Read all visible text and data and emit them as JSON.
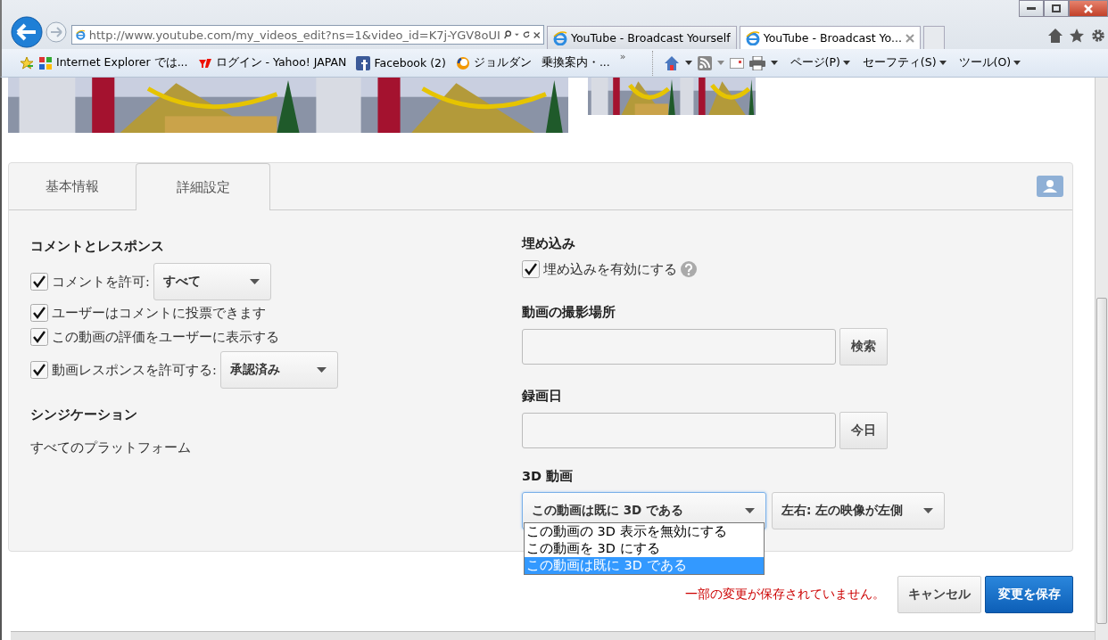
{
  "browser": {
    "address": "http://www.youtube.com/my_videos_edit?ns=1&video_id=K7j-YGV8oUI",
    "tabs": [
      {
        "label": "YouTube - Broadcast Yourself",
        "selected": false
      },
      {
        "label": "YouTube - Broadcast Yo...",
        "selected": true
      }
    ],
    "favorites": [
      "Internet Explorer では...",
      "ログイン - Yahoo! JAPAN",
      "Facebook (2)",
      "ジョルダン",
      "乗換案内・..."
    ],
    "overflow_mark": "»",
    "commands": [
      "ページ(P)",
      "セーフティ(S)",
      "ツール(O)"
    ]
  },
  "page": {
    "tabs": [
      {
        "label": "基本情報",
        "selected": false
      },
      {
        "label": "詳細設定",
        "selected": true
      }
    ],
    "left": {
      "heading": "コメントとレスポンス",
      "options": [
        {
          "label": "コメントを許可:",
          "checked": true,
          "select": "すべて"
        },
        {
          "label": "ユーザーはコメントに投票できます",
          "checked": true
        },
        {
          "label": "この動画の評価をユーザーに表示する",
          "checked": true
        },
        {
          "label": "動画レスポンスを許可する:",
          "checked": true,
          "select": "承認済み"
        }
      ],
      "syndication_heading": "シンジケーション",
      "syndication_value": "すべてのプラットフォーム"
    },
    "right": {
      "embed_heading": "埋め込み",
      "embed": {
        "label": "埋め込みを有効にする",
        "checked": true
      },
      "location": {
        "heading": "動画の撮影場所",
        "button": "検索"
      },
      "date": {
        "heading": "録画日",
        "button": "今日"
      },
      "three_d": {
        "heading": "3D 動画",
        "select": "この動画は既に 3D である",
        "order_select": "左右: 左の映像が左側",
        "options": [
          {
            "label": "この動画の 3D 表示を無効にする",
            "selected": false
          },
          {
            "label": "この動画を 3D にする",
            "selected": false
          },
          {
            "label": "この動画は既に 3D である",
            "selected": true
          }
        ]
      }
    },
    "footer": {
      "message": "一部の変更が保存されていません。",
      "cancel": "キャンセル",
      "save": "変更を保存"
    }
  }
}
